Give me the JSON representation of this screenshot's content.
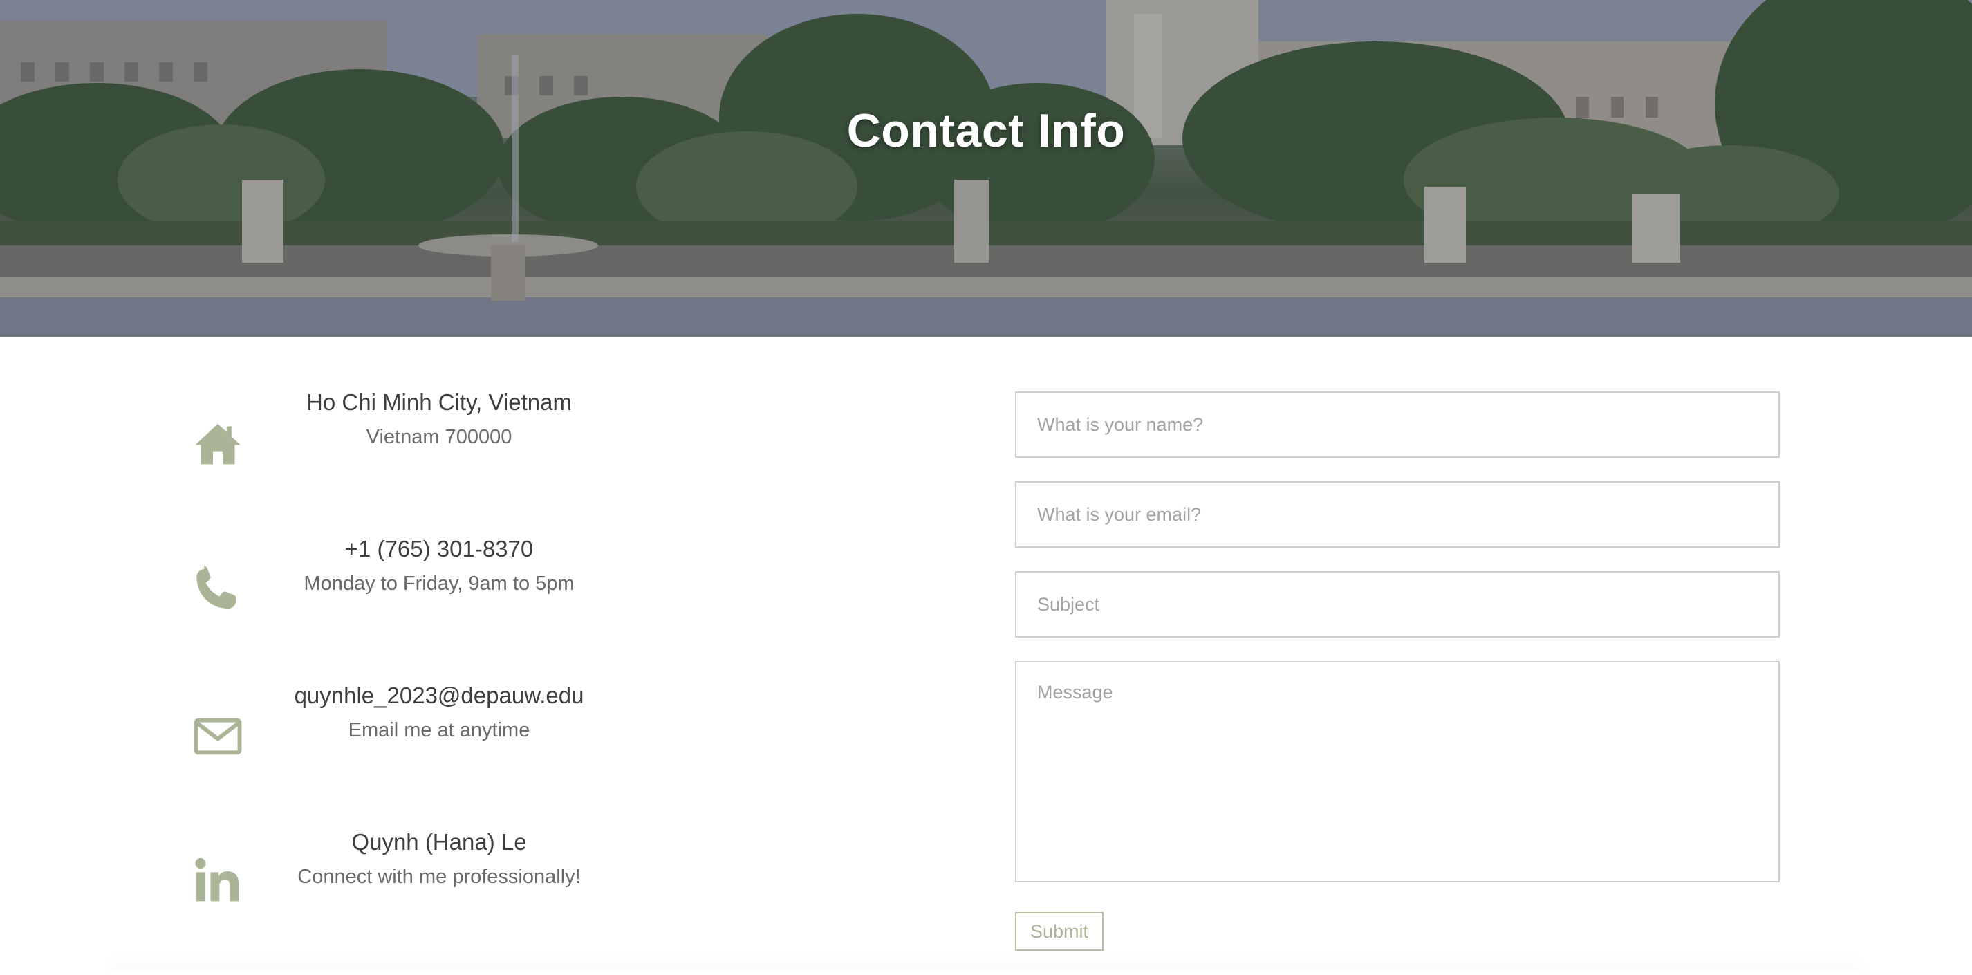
{
  "hero": {
    "title": "Contact Info"
  },
  "contacts": [
    {
      "icon": "home-icon",
      "primary": "Ho Chi Minh City, Vietnam",
      "secondary": "Vietnam 700000"
    },
    {
      "icon": "phone-icon",
      "primary": "+1 (765) 301-8370",
      "secondary": "Monday to Friday, 9am to 5pm"
    },
    {
      "icon": "envelope-icon",
      "primary": "quynhle_2023@depauw.edu",
      "secondary": "Email me at anytime"
    },
    {
      "icon": "linkedin-icon",
      "primary": "Quynh (Hana) Le",
      "secondary": "Connect with me professionally!"
    }
  ],
  "form": {
    "name_placeholder": "What is your name?",
    "email_placeholder": "What is your email?",
    "subject_placeholder": "Subject",
    "message_placeholder": "Message",
    "submit_label": "Submit"
  },
  "colors": {
    "icon": "#a9b596",
    "primary_text": "#3e3e3e",
    "secondary_text": "#6a6a6a",
    "field_border": "#cfcfcf",
    "submit_border": "#b4c0a3"
  }
}
